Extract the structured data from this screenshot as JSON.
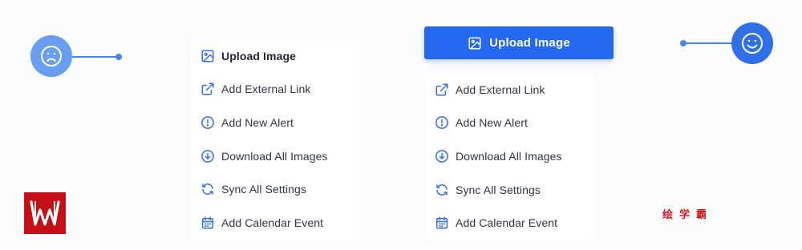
{
  "bad_example": {
    "menu": [
      {
        "label": "Upload Image",
        "icon": "image-icon"
      },
      {
        "label": "Add External Link",
        "icon": "external-link-icon"
      },
      {
        "label": "Add New Alert",
        "icon": "alert-circle-icon"
      },
      {
        "label": "Download All Images",
        "icon": "download-circle-icon"
      },
      {
        "label": "Sync All Settings",
        "icon": "sync-icon"
      },
      {
        "label": "Add Calendar Event",
        "icon": "calendar-icon"
      }
    ],
    "face": "sad-face-icon"
  },
  "good_example": {
    "primary_button": {
      "label": "Upload Image",
      "icon": "image-icon"
    },
    "menu": [
      {
        "label": "Add External Link",
        "icon": "external-link-icon"
      },
      {
        "label": "Add New Alert",
        "icon": "alert-circle-icon"
      },
      {
        "label": "Download All Images",
        "icon": "download-circle-icon"
      },
      {
        "label": "Sync All Settings",
        "icon": "sync-icon"
      },
      {
        "label": "Add Calendar Event",
        "icon": "calendar-icon"
      }
    ],
    "face": "happy-face-icon"
  },
  "watermark": {
    "brand_text": "绘学霸"
  },
  "colors": {
    "primary": "#2368ef",
    "icon": "#2f6fe8",
    "sad_face": "#6a9ef2",
    "happy_face": "#2f6fe8",
    "brand": "#c40f14"
  }
}
